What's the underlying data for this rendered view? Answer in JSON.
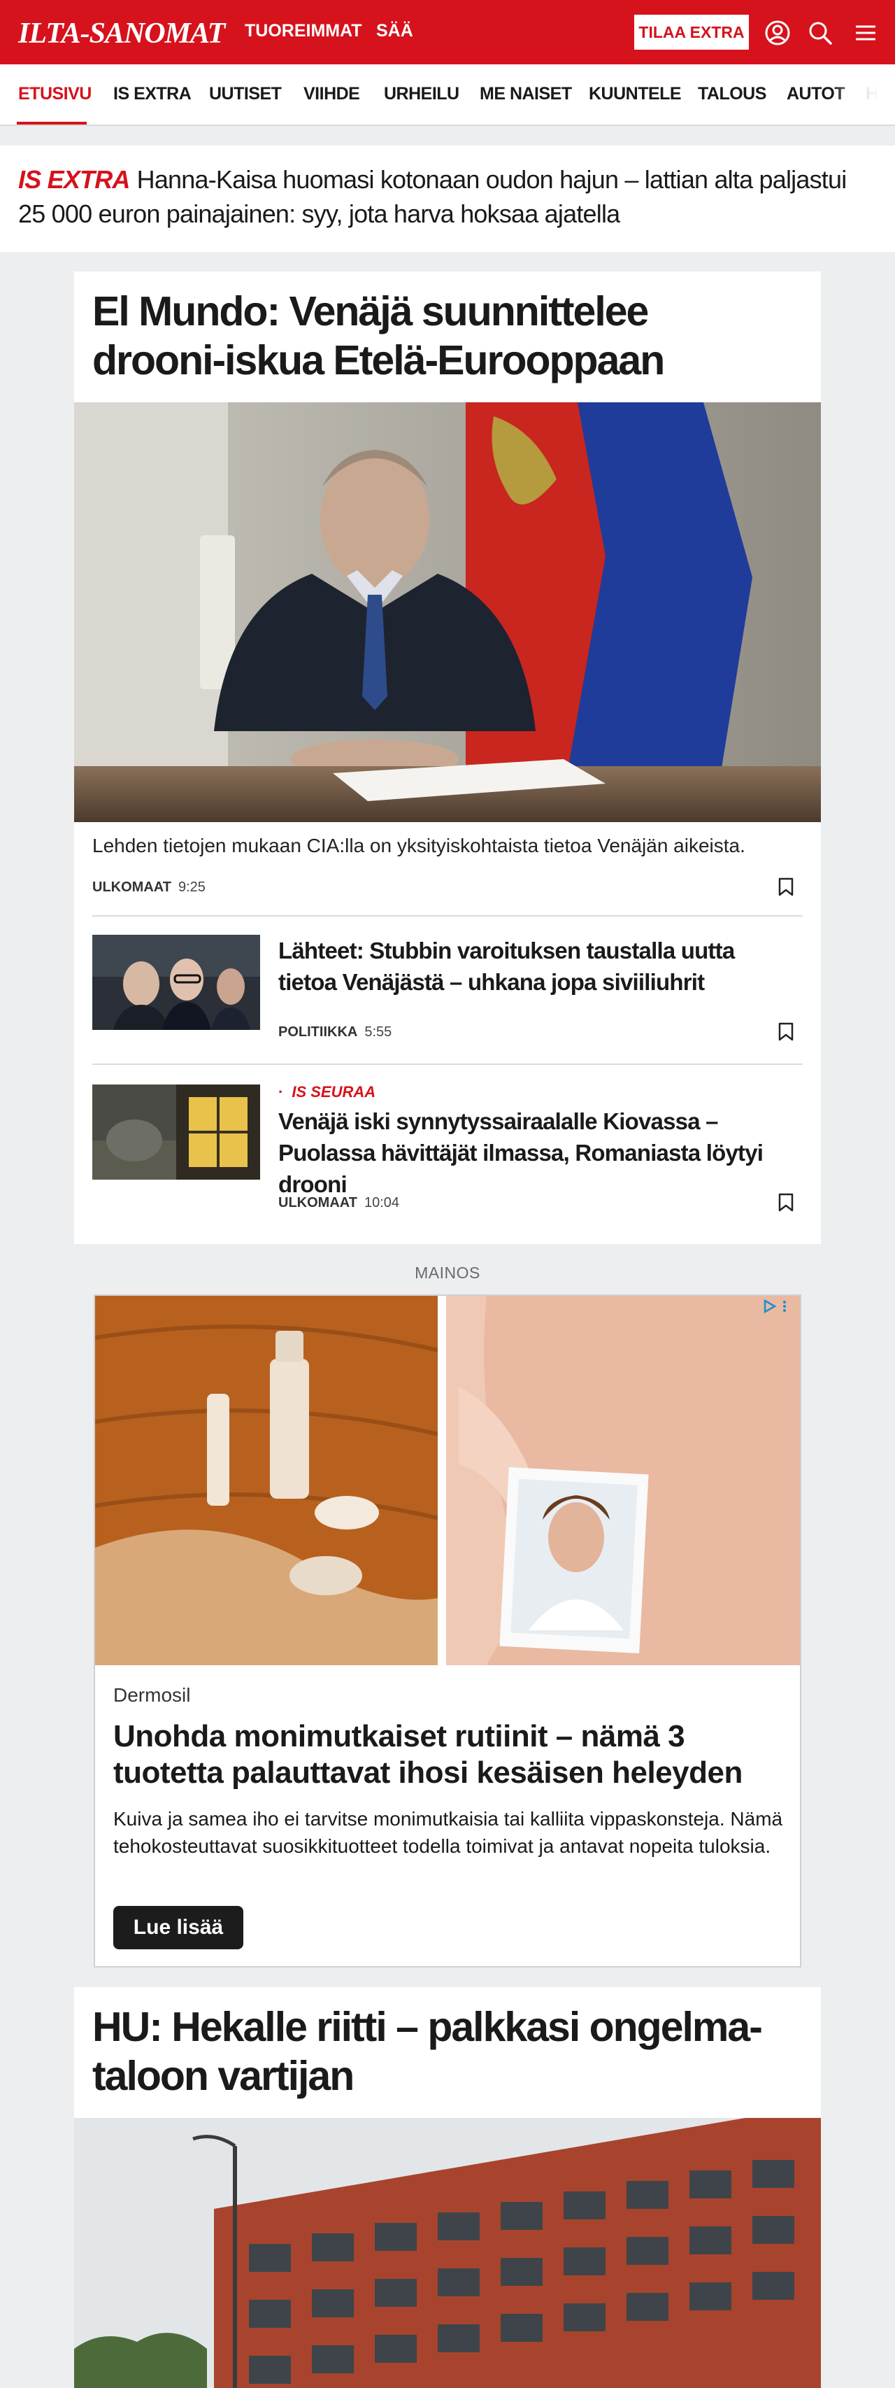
{
  "header": {
    "logo": "ILTA-SANOMAT",
    "nav": [
      "TUOREIMMAT",
      "SÄÄ"
    ],
    "subscribe": "TILAA EXTRA",
    "icons": [
      "user-icon",
      "search-icon",
      "menu-icon"
    ],
    "brand_color": "#d6121c"
  },
  "sections": [
    "ETUSIVU",
    "IS EXTRA",
    "UUTISET",
    "VIIHDE",
    "URHEILU",
    "ME NAISET",
    "KUUNTELE",
    "TALOUS",
    "AUTOT",
    "HY"
  ],
  "extra_banner": {
    "kicker": "IS EXTRA",
    "title": "Hanna-Kaisa huomasi kotonaan oudon hajun – lattian alta paljastui 25 000 euron painajainen: syy, jota harva hoksaa ajatella"
  },
  "main_article": {
    "headline": "El Mundo: Venäjä suunnittelee drooni-iskua Etelä-Eurooppaan",
    "lead": "Lehden tietojen mukaan CIA:lla on yksityiskohtaista tietoa Venäjän aikeista.",
    "category": "ULKOMAAT",
    "time": "9:25"
  },
  "related": [
    {
      "title": "Lähteet: Stubbin varoituksen taustalla uutta tietoa Venäjästä – uhkana jopa siviiliuhrit",
      "category": "POLITIIKKA",
      "time": "5:55"
    },
    {
      "kicker": "IS SEURAA",
      "title": "Venäjä iski synnytyssairaalalle Kiovassa – Puolassa hävittäjät ilmassa, Romaniasta löytyi drooni",
      "category": "ULKOMAAT",
      "time": "10:04"
    }
  ],
  "ad": {
    "label": "MAINOS",
    "brand": "Dermosil",
    "title": "Unohda monimutkaiset rutiinit – nämä 3 tuotetta palauttavat ihosi kesäisen heleyden",
    "body": "Kuiva ja samea iho ei tarvitse monimutkaisia tai kalliita vippaskonsteja. Nämä tehokosteuttavat suosikkituotteet todella toimivat ja antavat nopeita tuloksia.",
    "cta": "Lue lisää"
  },
  "second_article": {
    "headline": "HU: Hekalle riitti – palkkasi ongelma-taloon vartijan"
  }
}
